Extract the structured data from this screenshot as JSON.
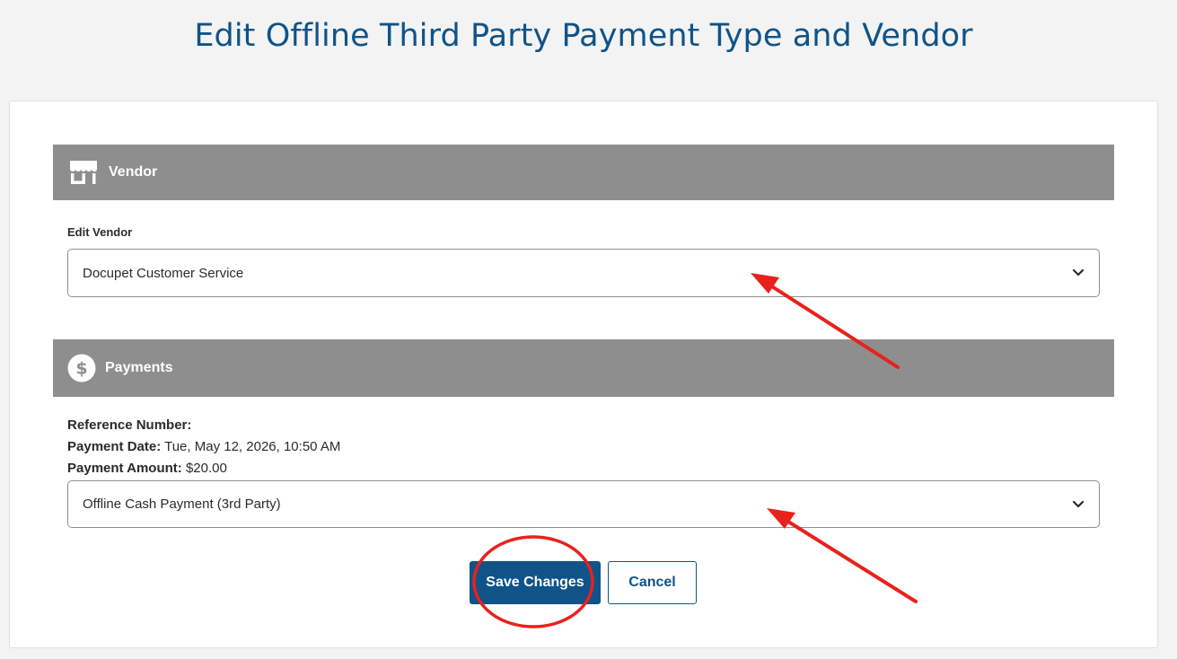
{
  "page": {
    "title": "Edit Offline Third Party Payment Type and Vendor"
  },
  "vendor": {
    "header": "Vendor",
    "header_icon": "storefront-icon",
    "field_label": "Edit Vendor",
    "selected": "Docupet Customer Service"
  },
  "payments": {
    "header": "Payments",
    "header_icon": "dollar-circle-icon",
    "reference_label": "Reference Number:",
    "reference_value": "",
    "date_label": "Payment Date:",
    "date_value": "Tue, May 12, 2026, 10:50 AM",
    "amount_label": "Payment Amount:",
    "amount_value": "$20.00",
    "type_selected": "Offline Cash Payment (3rd Party)"
  },
  "actions": {
    "save_label": "Save Changes",
    "cancel_label": "Cancel"
  },
  "colors": {
    "primary": "#0f5389",
    "header_bg": "#8e8e8e",
    "annotation": "#e8211c"
  }
}
